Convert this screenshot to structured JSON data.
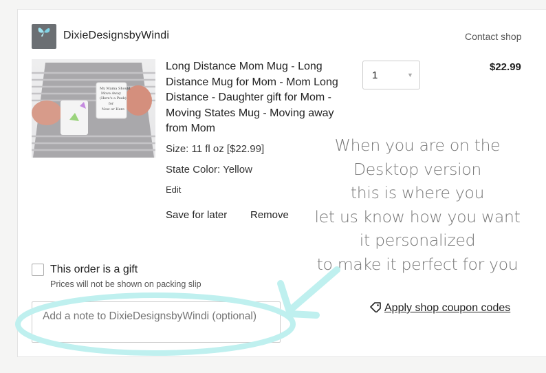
{
  "shop": {
    "name": "DixieDesignsbyWindi",
    "contact_label": "Contact shop"
  },
  "item": {
    "title": "Long Distance Mom Mug - Long Distance Mug for Mom - Mom Long Distance - Daughter gift for Mom - Moving States Mug - Moving away from Mom",
    "size": "Size: 11 fl oz [$22.99]",
    "state_color": "State Color: Yellow",
    "edit_label": "Edit",
    "save_label": "Save for later",
    "remove_label": "Remove",
    "quantity": "1",
    "price": "$22.99",
    "image_text": "My Mama Should Move Away (Here's a Peek) for Now or Here"
  },
  "annotation": {
    "lines": [
      "When you are on the",
      "Desktop version",
      "this is where you",
      "let us know how you want",
      "it personalized",
      "to make it perfect for you"
    ],
    "highlight_color": "#bff0ef"
  },
  "gift": {
    "label": "This order is a gift",
    "note": "Prices will not be shown on packing slip",
    "checked": false
  },
  "note_field": {
    "placeholder": "Add a note to DixieDesignsbyWindi (optional)"
  },
  "coupon": {
    "label": "Apply shop coupon codes",
    "icon": "tag-icon"
  }
}
